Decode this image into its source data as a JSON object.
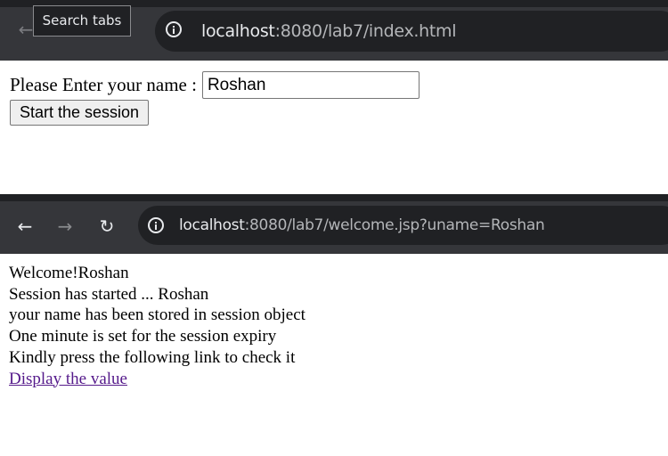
{
  "window1": {
    "tooltip": "Search tabs",
    "back_glyph": "←",
    "url_host": "localhost",
    "url_rest": ":8080/lab7/index.html",
    "form": {
      "label": "Please Enter your name :",
      "name_value": "Roshan",
      "submit_label": "Start the session"
    }
  },
  "window2": {
    "back_glyph": "←",
    "forward_glyph": "→",
    "reload_glyph": "↻",
    "url_host": "localhost",
    "url_rest": ":8080/lab7/welcome.jsp?uname=Roshan",
    "lines": [
      "Welcome!Roshan",
      "Session has started ... Roshan",
      "your name has been stored in session object",
      "One minute is set for the session expiry",
      "Kindly press the following link to check it"
    ],
    "link_text": "Display the value"
  },
  "colors": {
    "toolbar": "#35363a",
    "omnibox": "#202124",
    "url_text": "#e8eaed",
    "visited_link": "#551a8b"
  }
}
